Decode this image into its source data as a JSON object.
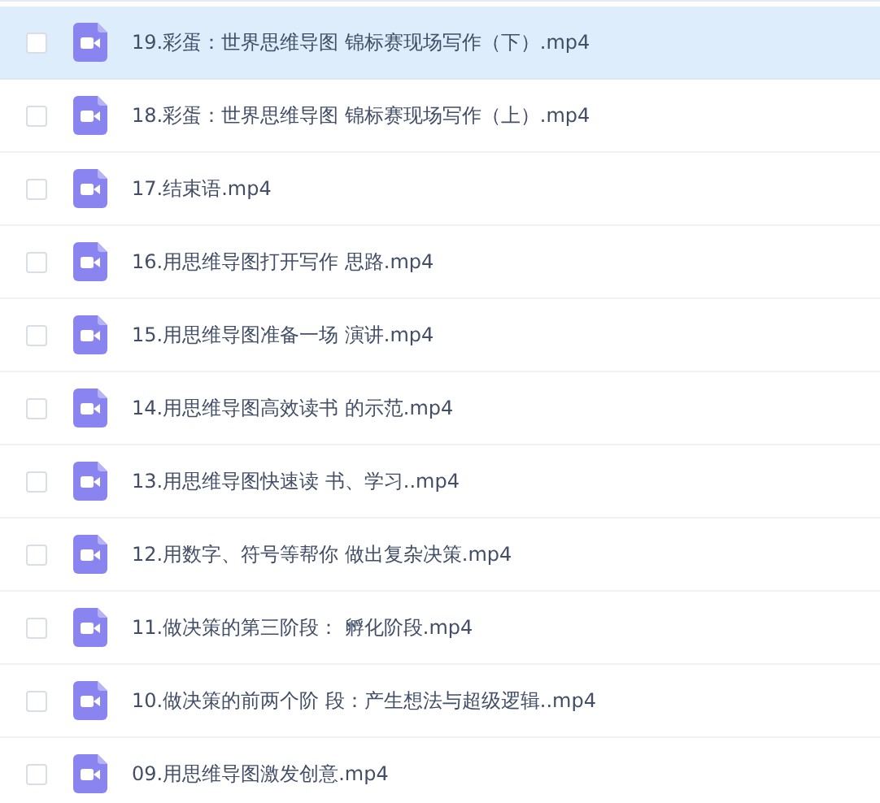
{
  "files": [
    {
      "name": "19.彩蛋：世界思维导图 锦标赛现场写作（下）.mp4",
      "checked": false,
      "selected": true
    },
    {
      "name": "18.彩蛋：世界思维导图 锦标赛现场写作（上）.mp4",
      "checked": false,
      "selected": false
    },
    {
      "name": "17.结束语.mp4",
      "checked": false,
      "selected": false
    },
    {
      "name": "16.用思维导图打开写作 思路.mp4",
      "checked": false,
      "selected": false
    },
    {
      "name": "15.用思维导图准备一场 演讲.mp4",
      "checked": false,
      "selected": false
    },
    {
      "name": "14.用思维导图高效读书 的示范.mp4",
      "checked": false,
      "selected": false
    },
    {
      "name": "13.用思维导图快速读 书、学习..mp4",
      "checked": false,
      "selected": false
    },
    {
      "name": "12.用数字、符号等帮你 做出复杂决策.mp4",
      "checked": false,
      "selected": false
    },
    {
      "name": "11.做决策的第三阶段： 孵化阶段.mp4",
      "checked": false,
      "selected": false
    },
    {
      "name": "10.做决策的前两个阶 段：产生想法与超级逻辑..mp4",
      "checked": false,
      "selected": false
    },
    {
      "name": "09.用思维导图激发创意.mp4",
      "checked": false,
      "selected": false
    }
  ]
}
